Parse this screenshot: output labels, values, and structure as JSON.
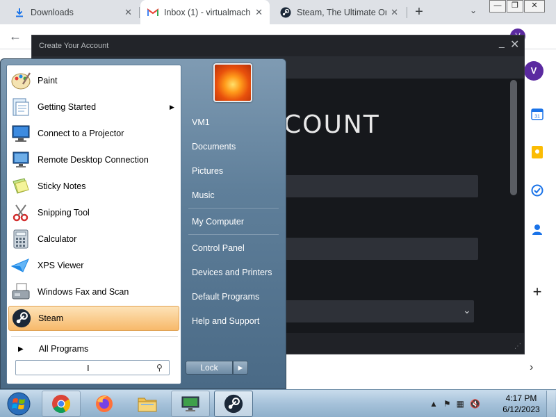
{
  "browser": {
    "tabs": [
      {
        "label": "Downloads",
        "icon": "download-icon"
      },
      {
        "label": "Inbox (1) - virtualmachi",
        "icon": "gmail-icon"
      },
      {
        "label": "Steam, The Ultimate On",
        "icon": "steam-icon"
      }
    ],
    "profile_initial": "V",
    "rail_avatar_initial": "V",
    "calendar_day": "31"
  },
  "steam_dialog": {
    "title": "Create Your Account",
    "heading": "COUNT"
  },
  "start_menu": {
    "programs": [
      {
        "label": "Paint",
        "icon": "paint-icon"
      },
      {
        "label": "Getting Started",
        "icon": "getting-started-icon",
        "has_submenu": true
      },
      {
        "label": "Connect to a Projector",
        "icon": "projector-icon"
      },
      {
        "label": "Remote Desktop Connection",
        "icon": "remote-desktop-icon"
      },
      {
        "label": "Sticky Notes",
        "icon": "sticky-notes-icon"
      },
      {
        "label": "Snipping Tool",
        "icon": "snipping-tool-icon"
      },
      {
        "label": "Calculator",
        "icon": "calculator-icon"
      },
      {
        "label": "XPS Viewer",
        "icon": "xps-viewer-icon"
      },
      {
        "label": "Windows Fax and Scan",
        "icon": "fax-scan-icon"
      },
      {
        "label": "Steam",
        "icon": "steam-icon",
        "highlighted": true
      }
    ],
    "all_programs": "All Programs",
    "places": [
      {
        "label": "VM1"
      },
      {
        "label": "Documents"
      },
      {
        "label": "Pictures"
      },
      {
        "label": "Music"
      },
      {
        "label": "My Computer"
      },
      {
        "label": "Control Panel"
      },
      {
        "label": "Devices and Printers"
      },
      {
        "label": "Default Programs"
      },
      {
        "label": "Help and Support"
      }
    ],
    "lock_label": "Lock"
  },
  "taskbar": {
    "apps": [
      {
        "name": "chrome-icon"
      },
      {
        "name": "firefox-icon"
      },
      {
        "name": "explorer-icon"
      },
      {
        "name": "remote-desktop-icon"
      },
      {
        "name": "steam-icon"
      }
    ],
    "clock_time": "4:17 PM",
    "clock_date": "6/12/2023"
  }
}
